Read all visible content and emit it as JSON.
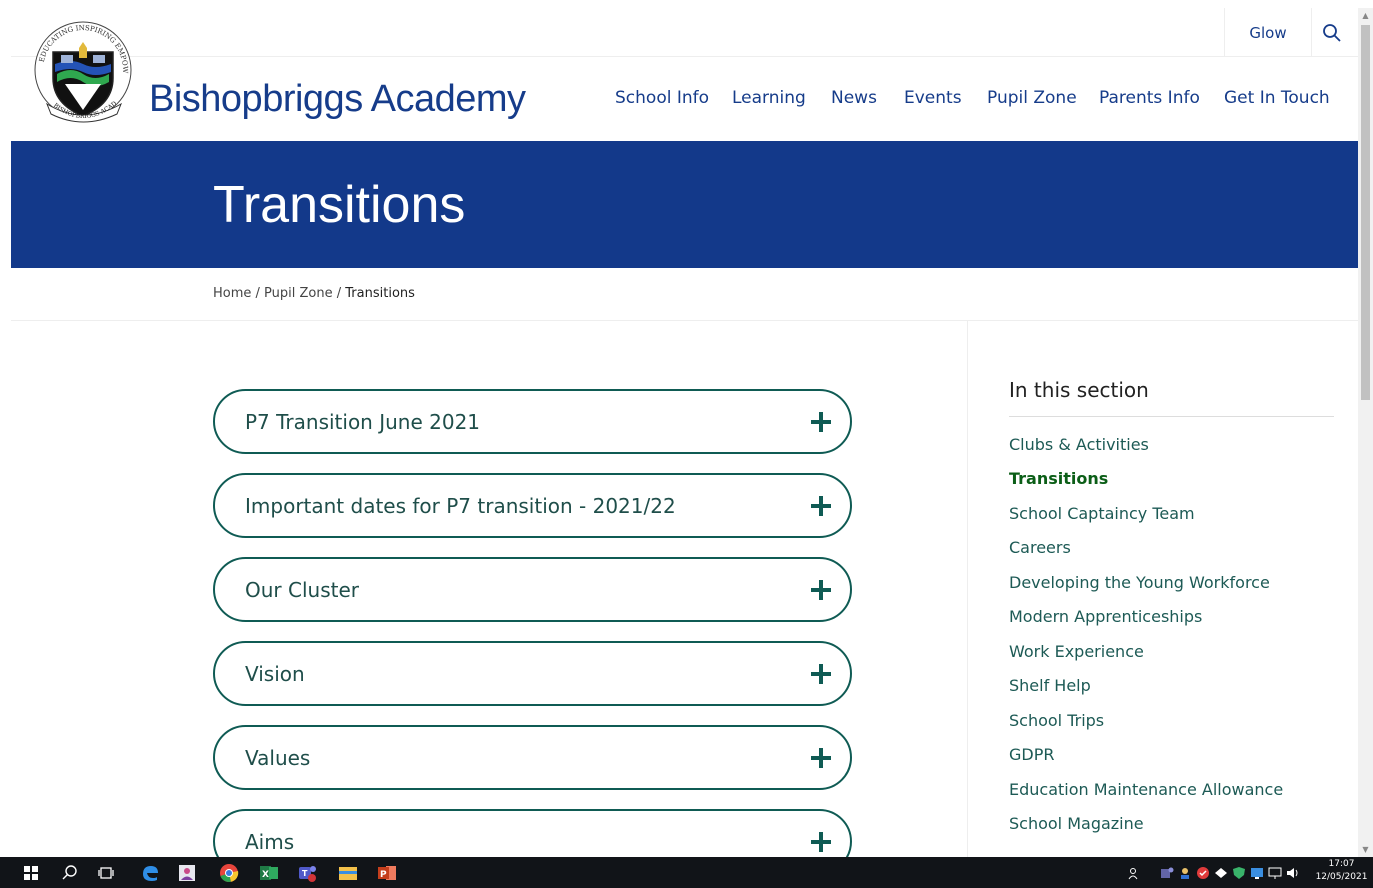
{
  "site": {
    "name": "Bishopbriggs Academy",
    "glow_label": "Glow",
    "logo_text": {
      "top": "EDUCATING INSPIRING EMPOWERING",
      "bottom": "BISHOPBRIGGS ACADEMY"
    }
  },
  "nav": {
    "items": [
      {
        "label": "School Info"
      },
      {
        "label": "Learning"
      },
      {
        "label": "News"
      },
      {
        "label": "Events"
      },
      {
        "label": "Pupil Zone"
      },
      {
        "label": "Parents Info"
      },
      {
        "label": "Get In Touch"
      }
    ]
  },
  "banner": {
    "title": "Transitions"
  },
  "breadcrumb": {
    "home": "Home",
    "sep1": " / ",
    "section": "Pupil Zone",
    "sep2": " / ",
    "current": "Transitions"
  },
  "accordion": {
    "items": [
      {
        "label": "P7 Transition June 2021"
      },
      {
        "label": "Important dates for P7 transition - 2021/22"
      },
      {
        "label": "Our Cluster"
      },
      {
        "label": "Vision"
      },
      {
        "label": "Values"
      },
      {
        "label": "Aims"
      }
    ]
  },
  "sidebar": {
    "title": "In this section",
    "links": [
      {
        "label": "Clubs & Activities"
      },
      {
        "label": "Transitions",
        "active": true
      },
      {
        "label": "School Captaincy Team"
      },
      {
        "label": "Careers"
      },
      {
        "label": "Developing the Young Workforce"
      },
      {
        "label": "Modern Apprenticeships"
      },
      {
        "label": "Work Experience"
      },
      {
        "label": "Shelf Help"
      },
      {
        "label": "School Trips"
      },
      {
        "label": "GDPR"
      },
      {
        "label": "Education Maintenance Allowance"
      },
      {
        "label": "School Magazine"
      }
    ]
  },
  "taskbar": {
    "clock_time": "17:07",
    "clock_date": "12/05/2021",
    "apps": [
      "windows-start-icon",
      "search-icon",
      "task-view-icon",
      "edge-icon",
      "people-app-icon",
      "chrome-icon",
      "excel-icon",
      "teams-icon",
      "file-explorer-icon",
      "powerpoint-icon"
    ]
  },
  "colors": {
    "brand_blue": "#13398a",
    "nav_blue": "#163c8a",
    "teal": "#0f5b54",
    "active_green": "#0b5e17"
  }
}
